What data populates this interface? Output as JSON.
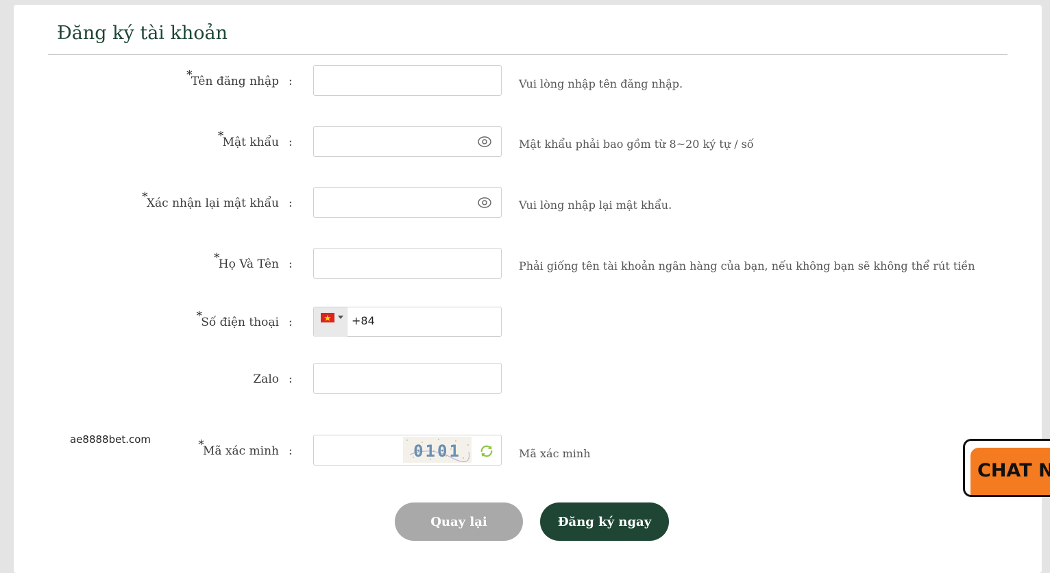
{
  "form": {
    "title": "Đăng ký tài khoản",
    "required_mark": "*",
    "colon": ":",
    "fields": {
      "username": {
        "label": "Tên đăng nhập",
        "value": "",
        "hint": "Vui lòng nhập tên đăng nhập."
      },
      "password": {
        "label": "Mật khẩu",
        "value": "",
        "hint": "Mật khẩu phải bao gồm từ 8~20 ký tự / số",
        "icon": "eye-icon"
      },
      "confirm_password": {
        "label": "Xác nhận lại mật khẩu",
        "value": "",
        "hint": "Vui lòng nhập lại mật khẩu.",
        "icon": "eye-icon"
      },
      "full_name": {
        "label": "Họ Và Tên",
        "value": "",
        "hint": "Phải giống tên tài khoản ngân hàng của bạn, nếu không bạn sẽ không thể rút tiền"
      },
      "phone": {
        "label": "Số điện thoại",
        "value": "+84",
        "flag": "vietnam-flag-icon"
      },
      "zalo": {
        "label": "Zalo",
        "value": ""
      },
      "captcha": {
        "label": "Mã xác minh",
        "value": "",
        "captcha_text": "0101",
        "hint": "Mã xác minh",
        "icon": "refresh-icon"
      }
    },
    "buttons": {
      "back": "Quay lại",
      "submit": "Đăng ký ngay"
    }
  },
  "watermark": "ae8888bet.com",
  "chat_widget": {
    "label": "CHAT N"
  },
  "colors": {
    "brand_green": "#1f4634",
    "button_gray": "#a9a9a9",
    "chat_orange": "#f47b20",
    "page_bg": "#e4e4e4"
  }
}
